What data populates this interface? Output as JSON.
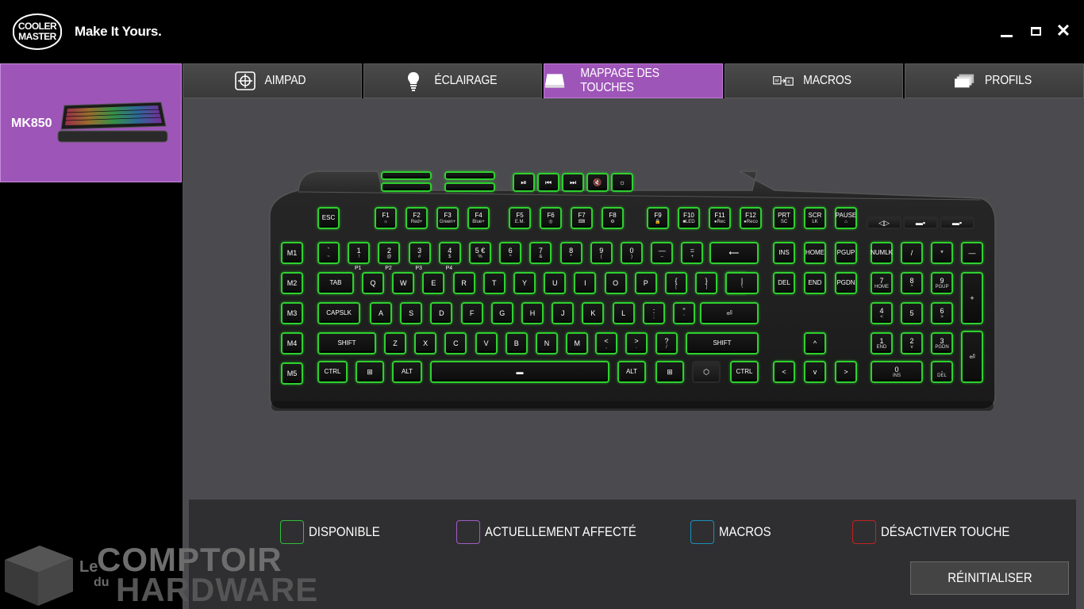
{
  "brand": {
    "logo_line1": "COOLER",
    "logo_line2": "MASTER",
    "tagline": "Make It Yours."
  },
  "window_controls": {
    "minimize_icon": "minimize-icon",
    "maximize_icon": "maximize-icon",
    "close_glyph": "✕"
  },
  "sidebar": {
    "devices": [
      {
        "name": "MK850",
        "selected": true
      }
    ]
  },
  "tabs": [
    {
      "label": "AIMPAD",
      "icon": "crosshair-icon",
      "active": false
    },
    {
      "label": "ÉCLAIRAGE",
      "icon": "lightbulb-icon",
      "active": false
    },
    {
      "label": "MAPPAGE DES TOUCHES",
      "icon": "keycap-icon",
      "active": true
    },
    {
      "label": "MACROS",
      "icon": "macro-icon",
      "active": false
    },
    {
      "label": "PROFILS",
      "icon": "profiles-icon",
      "active": false
    }
  ],
  "keyboard": {
    "key_color": "#2fd02f",
    "top_buttons": [
      "⏯",
      "⏮",
      "⏭",
      "🔇",
      "☼"
    ],
    "escape": "ESC",
    "function_keys": [
      {
        "label": "F1",
        "sub": "☼"
      },
      {
        "label": "F2",
        "sub": "Red+"
      },
      {
        "label": "F3",
        "sub": "Green+"
      },
      {
        "label": "F4",
        "sub": "Blue+"
      },
      {
        "label": "F5",
        "sub": "E.M."
      },
      {
        "label": "F6",
        "sub": "◎"
      },
      {
        "label": "F7",
        "sub": "⌨"
      },
      {
        "label": "F8",
        "sub": "⚙"
      },
      {
        "label": "F9",
        "sub": "🔒"
      },
      {
        "label": "F10",
        "sub": "■LED"
      },
      {
        "label": "F11",
        "sub": "●Rec"
      },
      {
        "label": "F12",
        "sub": "●Reco"
      }
    ],
    "nav_top": [
      {
        "label": "PRT",
        "sub": "SC"
      },
      {
        "label": "SCR",
        "sub": "LK"
      },
      {
        "label": "PAUSE",
        "sub": "⌂"
      }
    ],
    "macro_keys": [
      "M1",
      "M2",
      "M3",
      "M4",
      "M5"
    ],
    "row_numbers": [
      {
        "top": "`",
        "bot": "~"
      },
      {
        "top": "1",
        "bot": "!"
      },
      {
        "top": "2",
        "bot": "@"
      },
      {
        "top": "3",
        "bot": "#"
      },
      {
        "top": "4",
        "bot": "$"
      },
      {
        "top": "5 €",
        "bot": "%"
      },
      {
        "top": "6",
        "bot": "^"
      },
      {
        "top": "7",
        "bot": "&"
      },
      {
        "top": "8",
        "bot": "*"
      },
      {
        "top": "9",
        "bot": "("
      },
      {
        "top": "0",
        "bot": ")"
      },
      {
        "top": "—",
        "bot": "–"
      },
      {
        "top": "=",
        "bot": "+"
      }
    ],
    "profile_markers": [
      "P1",
      "P2",
      "P3",
      "P4"
    ],
    "backspace": "⟵",
    "tab": "TAB",
    "row_qwerty": [
      "Q",
      "W",
      "E",
      "R",
      "T",
      "Y",
      "U",
      "I",
      "O",
      "P"
    ],
    "brackets": [
      {
        "top": "{",
        "bot": "["
      },
      {
        "top": "}",
        "bot": "]"
      },
      {
        "top": "|",
        "bot": "\\"
      }
    ],
    "capslock": "CAPSLK",
    "row_asdf": [
      "A",
      "S",
      "D",
      "F",
      "G",
      "H",
      "J",
      "K",
      "L"
    ],
    "semi": {
      "top": ":",
      "bot": ";"
    },
    "quote": {
      "top": "\"",
      "bot": "'"
    },
    "enter": "⏎",
    "shift": "SHIFT",
    "row_zxcv": [
      "Z",
      "X",
      "C",
      "V",
      "B",
      "N",
      "M"
    ],
    "comma": {
      "top": "<",
      "bot": ","
    },
    "period": {
      "top": ">",
      "bot": "."
    },
    "slash": {
      "top": "?",
      "bot": "/"
    },
    "ctrl": "CTRL",
    "alt": "ALT",
    "win_icon": "windows-icon",
    "fn_icon": "cm-logo-icon",
    "nav_cluster": [
      [
        "INS",
        "HOME",
        "PGUP"
      ],
      [
        "DEL",
        "END",
        "PGDN"
      ]
    ],
    "arrows": {
      "up": "^",
      "left": "<",
      "down": "v",
      "right": ">"
    },
    "numpad": {
      "numlk": "NUMLK",
      "divide": "/",
      "multiply": "*",
      "minus": "—",
      "plus": "+",
      "enter": "⏎",
      "n7": {
        "top": "7",
        "bot": "HOME"
      },
      "n8": {
        "top": "8",
        "bot": "^"
      },
      "n9": {
        "top": "9",
        "bot": "PGUP"
      },
      "n4": {
        "top": "4",
        "bot": "<"
      },
      "n5": {
        "top": "5",
        "bot": ""
      },
      "n6": {
        "top": "6",
        "bot": ">"
      },
      "n1": {
        "top": "1",
        "bot": "END"
      },
      "n2": {
        "top": "2",
        "bot": "v"
      },
      "n3": {
        "top": "3",
        "bot": "PGDN"
      },
      "n0": {
        "top": "0",
        "bot": "INS"
      },
      "ndot": {
        "top": ".",
        "bot": "DEL"
      }
    }
  },
  "legend": [
    {
      "label": "DISPONIBLE",
      "color": "#2fbf3a"
    },
    {
      "label": "ACTUELLEMENT AFFECTÉ",
      "color": "#a05cc4"
    },
    {
      "label": "MACROS",
      "color": "#1b8fb8"
    },
    {
      "label": "DÉSACTIVER TOUCHE",
      "color": "#c0241f"
    }
  ],
  "reset_label": "RÉINITIALISER",
  "watermark": {
    "le": "Le",
    "du": "du",
    "comptoir": "COMPTOIR",
    "hardware": "HARDWARE"
  }
}
